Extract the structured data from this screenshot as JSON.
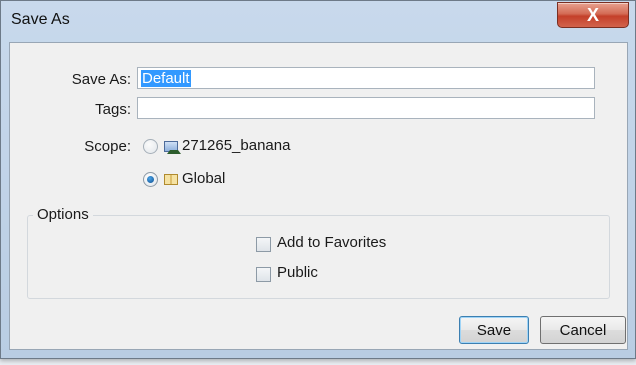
{
  "window": {
    "title": "Save As",
    "close_label": "X"
  },
  "form": {
    "save_as_label": "Save As:",
    "save_as_value": "Default",
    "tags_label": "Tags:",
    "tags_value": "",
    "scope_label": "Scope:",
    "scope_options": [
      {
        "label": "271265_banana",
        "icon": "image-icon",
        "selected": false
      },
      {
        "label": "Global",
        "icon": "book-icon",
        "selected": true
      }
    ]
  },
  "options": {
    "legend": "Options",
    "items": [
      {
        "label": "Add to Favorites",
        "checked": false
      },
      {
        "label": "Public",
        "checked": false
      }
    ]
  },
  "buttons": {
    "save_label": "Save",
    "cancel_label": "Cancel"
  }
}
